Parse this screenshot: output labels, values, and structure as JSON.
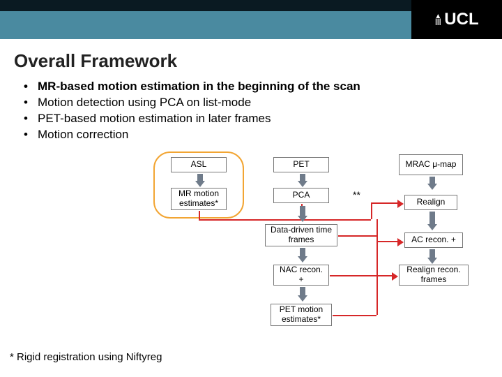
{
  "header": {
    "logo_text": "UCL"
  },
  "title": "Overall Framework",
  "bullets": [
    {
      "text": "MR-based motion estimation in the beginning of the scan",
      "strong": true
    },
    {
      "text": "Motion detection using PCA on list-mode",
      "strong": false
    },
    {
      "text": "PET-based motion estimation in later frames",
      "strong": false
    },
    {
      "text": "Motion correction",
      "strong": false
    }
  ],
  "diagram": {
    "asl": "ASL",
    "pet": "PET",
    "mrac": "MRAC μ-map",
    "mr_motion": "MR motion estimates*",
    "pca": "PCA",
    "realign": "Realign",
    "ddtf": "Data-driven time frames",
    "ac_recon": "AC recon. +",
    "nac_recon": "NAC recon. +",
    "realign_recon": "Realign recon. frames",
    "pet_motion": "PET motion estimates*",
    "asterisks": "**"
  },
  "footnote": "* Rigid registration using Niftyreg"
}
